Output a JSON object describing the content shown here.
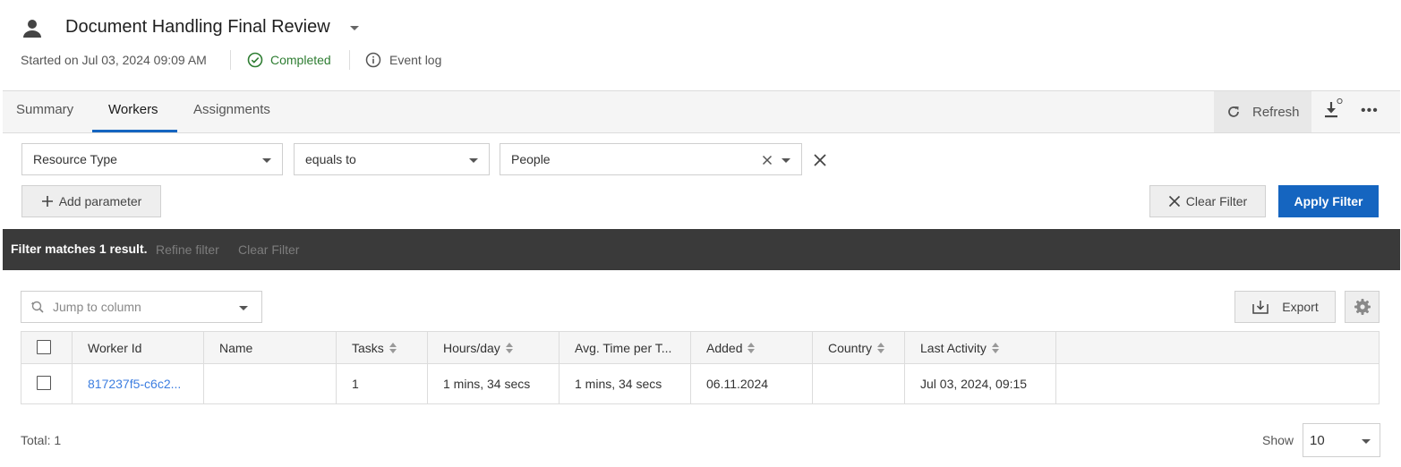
{
  "header": {
    "title": "Document Handling Final Review",
    "started": "Started on Jul 03, 2024 09:09 AM",
    "status": "Completed",
    "event_log": "Event log"
  },
  "tabs": [
    {
      "label": "Summary"
    },
    {
      "label": "Workers"
    },
    {
      "label": "Assignments"
    }
  ],
  "active_tab": "Workers",
  "toolbar": {
    "refresh_label": "Refresh"
  },
  "filter": {
    "field": "Resource Type",
    "operator": "equals to",
    "value": "People",
    "add_parameter_label": "Add parameter",
    "clear_filter_label": "Clear Filter",
    "apply_filter_label": "Apply Filter"
  },
  "result_bar": {
    "text": "Filter matches 1 result.",
    "refine_label": "Refine filter",
    "clear_label": "Clear Filter"
  },
  "grid_tools": {
    "jump_placeholder": "Jump to column",
    "export_label": "Export"
  },
  "table": {
    "columns": [
      {
        "label": "Worker Id",
        "sortable": false
      },
      {
        "label": "Name",
        "sortable": false
      },
      {
        "label": "Tasks",
        "sortable": true
      },
      {
        "label": "Hours/day",
        "sortable": true
      },
      {
        "label": "Avg. Time per T...",
        "sortable": false
      },
      {
        "label": "Added",
        "sortable": true
      },
      {
        "label": "Country",
        "sortable": true
      },
      {
        "label": "Last Activity",
        "sortable": true
      }
    ],
    "rows": [
      {
        "worker_id": "817237f5-c6c2...",
        "name": "",
        "tasks": "1",
        "hours_day": "1 mins, 34 secs",
        "avg_time": "1 mins, 34 secs",
        "added": "06.11.2024",
        "country": "",
        "last_activity": "Jul 03, 2024, 09:15"
      }
    ]
  },
  "footer": {
    "total": "Total: 1",
    "show_label": "Show",
    "page_size": "10"
  },
  "colors": {
    "accent": "#1565c0",
    "success": "#2e7d32",
    "link": "#3d7ee0",
    "result_bar": "#3a3a3a"
  }
}
